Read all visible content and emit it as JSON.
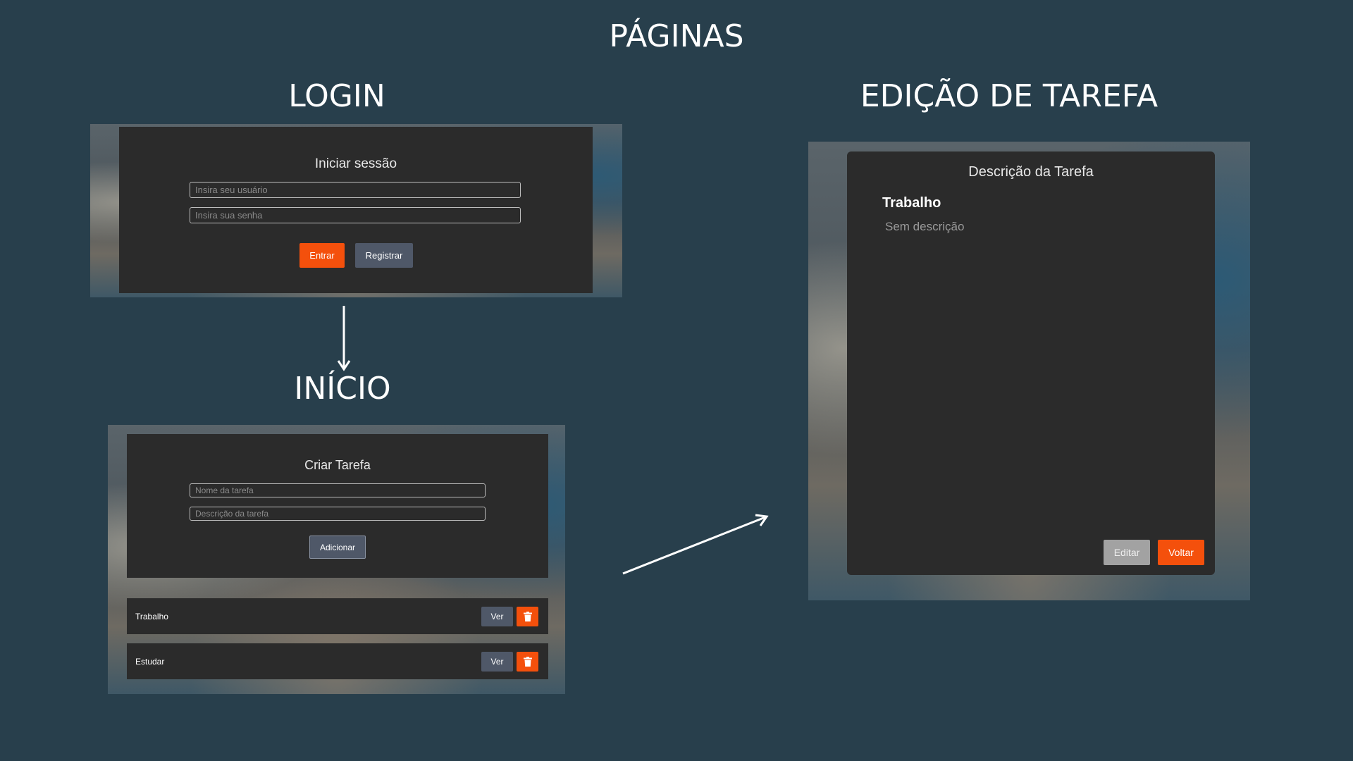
{
  "titles": {
    "page": "PÁGINAS",
    "login": "LOGIN",
    "home": "INÍCIO",
    "edit": "EDIÇÃO DE TAREFA"
  },
  "login": {
    "card_title": "Iniciar sessão",
    "user_placeholder": "Insira seu usuário",
    "password_placeholder": "Insira sua senha",
    "enter_label": "Entrar",
    "register_label": "Registrar"
  },
  "home": {
    "card_title": "Criar Tarefa",
    "name_placeholder": "Nome da tarefa",
    "description_placeholder": "Descrição da tarefa",
    "add_label": "Adicionar",
    "tasks": [
      {
        "name": "Trabalho",
        "view_label": "Ver",
        "delete_icon": "trash-icon"
      },
      {
        "name": "Estudar",
        "view_label": "Ver",
        "delete_icon": "trash-icon"
      }
    ]
  },
  "edit": {
    "card_title": "Descrição da Tarefa",
    "task_name": "Trabalho",
    "task_description": "Sem descrição",
    "edit_label": "Editar",
    "back_label": "Voltar"
  },
  "colors": {
    "background": "#283f4c",
    "panel": "#2b2b2b",
    "accent_orange": "#f4500c",
    "slate_button": "#4f5868",
    "gray_button": "#a2a2a2"
  }
}
